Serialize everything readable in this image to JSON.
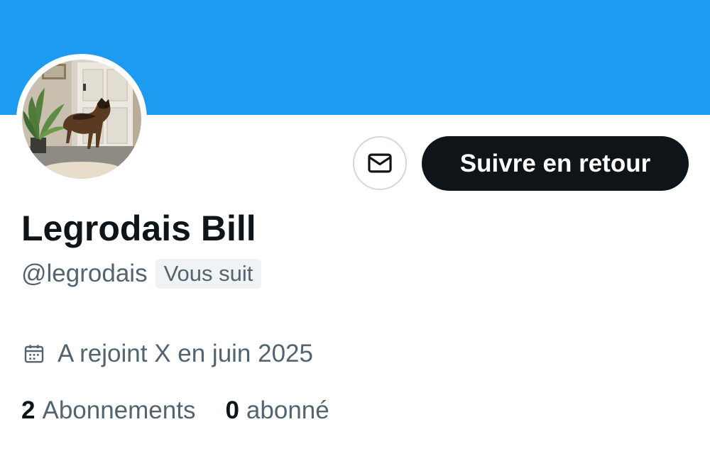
{
  "profile": {
    "display_name": "Legrodais Bill",
    "handle": "@legrodais",
    "follows_you_badge": "Vous suit",
    "joined": "A rejoint X en juin 2025"
  },
  "actions": {
    "message_icon": "envelope-icon",
    "follow_back_label": "Suivre en retour"
  },
  "stats": {
    "following_count": "2",
    "following_label": "Abonnements",
    "followers_count": "0",
    "followers_label": "abonné"
  },
  "colors": {
    "banner": "#1d9bf0",
    "primary_text": "#0f1419",
    "secondary_text": "#536471",
    "button_dark": "#0f1419",
    "badge_bg": "#eff3f4",
    "border": "#cfd9de"
  }
}
